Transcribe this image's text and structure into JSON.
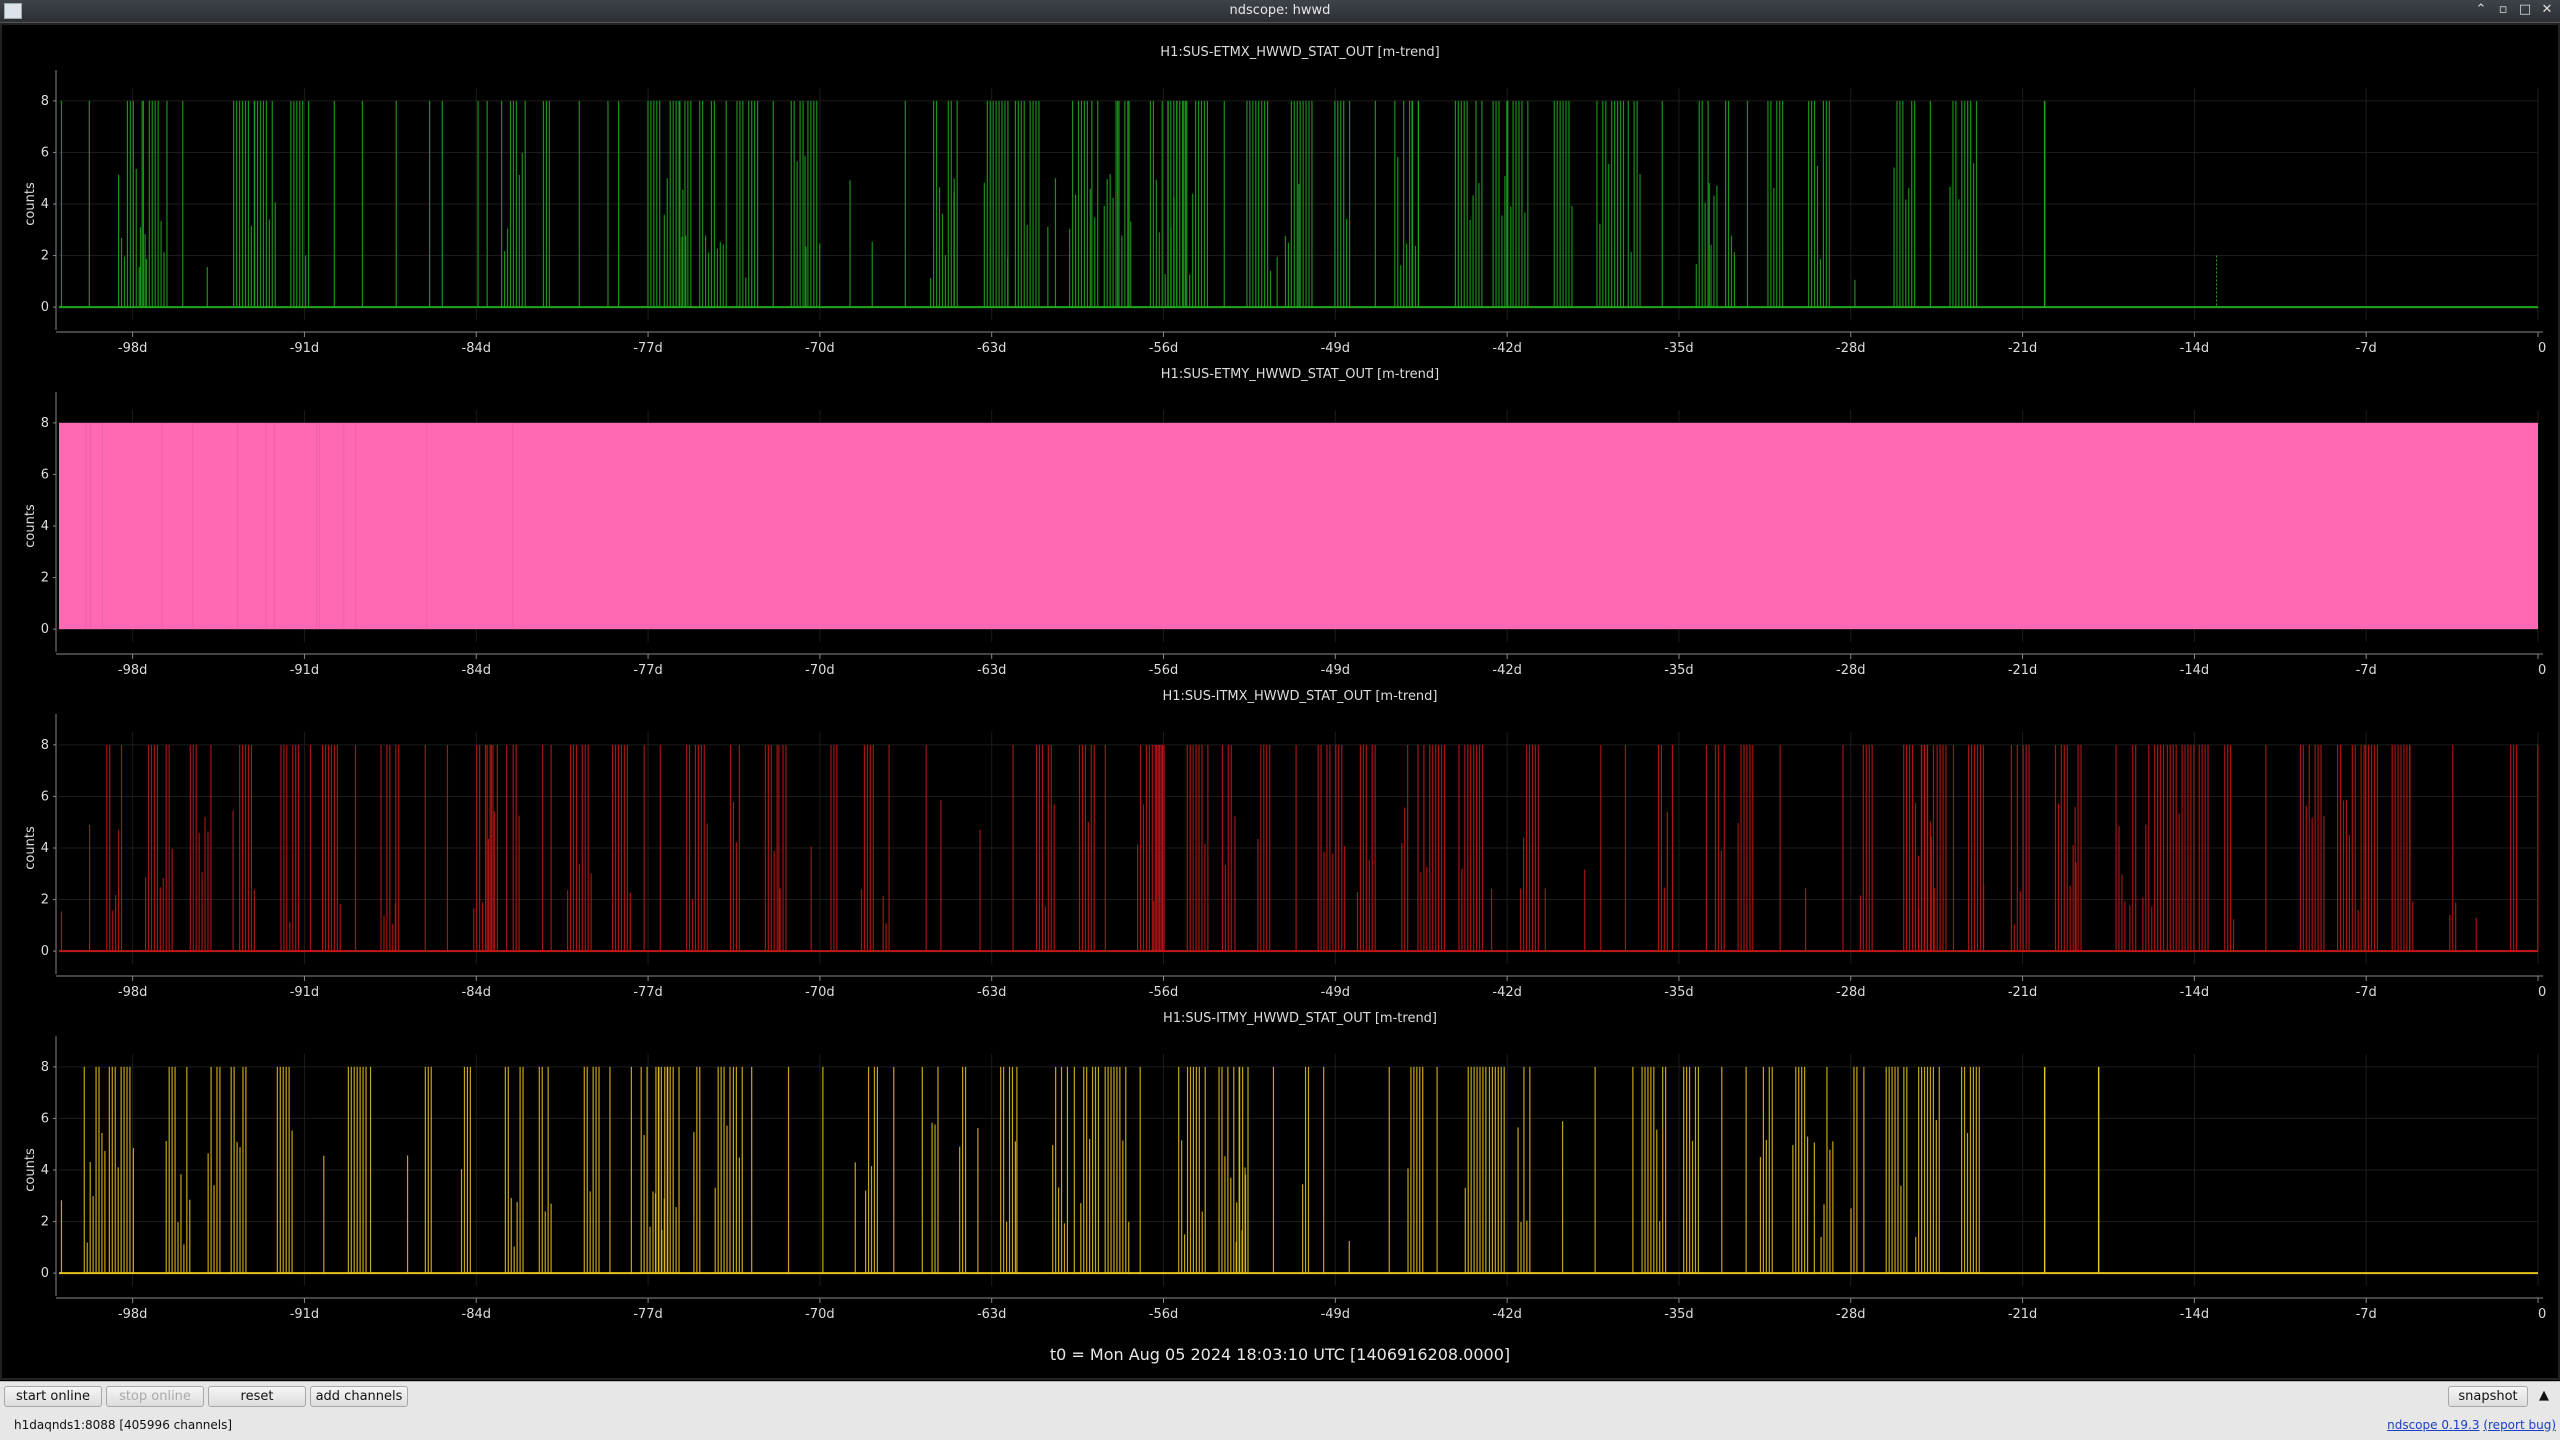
{
  "window": {
    "title": "ndscope: hwwd"
  },
  "plots": [
    {
      "title": "H1:SUS-ETMX_HWWD_STAT_OUT [m-trend]",
      "ylabel": "counts",
      "color": "#1fa81f",
      "style": "sparse",
      "activity_end_day": -22.5
    },
    {
      "title": "H1:SUS-ETMY_HWWD_STAT_OUT [m-trend]",
      "ylabel": "counts",
      "color": "#ff69b4",
      "style": "filled",
      "activity_end_day": 0
    },
    {
      "title": "H1:SUS-ITMX_HWWD_STAT_OUT [m-trend]",
      "ylabel": "counts",
      "color": "#c41818",
      "style": "sparse",
      "activity_end_day": 0
    },
    {
      "title": "H1:SUS-ITMY_HWWD_STAT_OUT [m-trend]",
      "ylabel": "counts",
      "color": "#e6c21c",
      "style": "sparse",
      "activity_end_day": -22.5
    }
  ],
  "chart_data": [
    {
      "type": "line",
      "title": "H1:SUS-ETMX_HWWD_STAT_OUT [m-trend]",
      "xlabel": "",
      "ylabel": "counts",
      "xlim": [
        -101,
        0
      ],
      "ylim": [
        -0.5,
        8.5
      ],
      "x_ticks": [
        "-98d",
        "-91d",
        "-84d",
        "-77d",
        "-70d",
        "-63d",
        "-56d",
        "-49d",
        "-42d",
        "-35d",
        "-28d",
        "-21d",
        "-14d",
        "-7d",
        "0"
      ],
      "y_ticks": [
        "0",
        "2",
        "4",
        "6",
        "8"
      ],
      "series": [
        {
          "values_range": [
            0,
            8
          ]
        }
      ]
    },
    {
      "type": "area",
      "title": "H1:SUS-ETMY_HWWD_STAT_OUT [m-trend]",
      "xlabel": "",
      "ylabel": "counts",
      "xlim": [
        -101,
        0
      ],
      "ylim": [
        -0.5,
        8.5
      ],
      "x_ticks": [
        "-98d",
        "-91d",
        "-84d",
        "-77d",
        "-70d",
        "-63d",
        "-56d",
        "-49d",
        "-42d",
        "-35d",
        "-28d",
        "-21d",
        "-14d",
        "-7d",
        "0"
      ],
      "y_ticks": [
        "0",
        "2",
        "4",
        "6",
        "8"
      ],
      "series": [
        {
          "values_range": [
            0,
            8
          ]
        }
      ]
    },
    {
      "type": "line",
      "title": "H1:SUS-ITMX_HWWD_STAT_OUT [m-trend]",
      "xlabel": "",
      "ylabel": "counts",
      "xlim": [
        -101,
        0
      ],
      "ylim": [
        -0.5,
        8.5
      ],
      "x_ticks": [
        "-98d",
        "-91d",
        "-84d",
        "-77d",
        "-70d",
        "-63d",
        "-56d",
        "-49d",
        "-42d",
        "-35d",
        "-28d",
        "-21d",
        "-14d",
        "-7d",
        "0"
      ],
      "y_ticks": [
        "0",
        "2",
        "4",
        "6",
        "8"
      ],
      "series": [
        {
          "values_range": [
            0,
            8
          ]
        }
      ]
    },
    {
      "type": "line",
      "title": "H1:SUS-ITMY_HWWD_STAT_OUT [m-trend]",
      "xlabel": "",
      "ylabel": "counts",
      "xlim": [
        -101,
        0
      ],
      "ylim": [
        -0.5,
        8.5
      ],
      "x_ticks": [
        "-98d",
        "-91d",
        "-84d",
        "-77d",
        "-70d",
        "-63d",
        "-56d",
        "-49d",
        "-42d",
        "-35d",
        "-28d",
        "-21d",
        "-14d",
        "-7d",
        "0"
      ],
      "y_ticks": [
        "0",
        "2",
        "4",
        "6",
        "8"
      ],
      "series": [
        {
          "values_range": [
            0,
            8
          ]
        }
      ]
    }
  ],
  "t0_label": "t0 = Mon Aug 05 2024 18:03:10 UTC [1406916208.0000]",
  "buttons": {
    "start_online": "start online",
    "stop_online": "stop online",
    "reset": "reset",
    "add_channels": "add channels",
    "snapshot": "snapshot"
  },
  "status": {
    "server": "h1daqnds1:8088  [405996 channels]",
    "version_link": "ndscope 0.19.3",
    "report_link": "(report bug)"
  }
}
